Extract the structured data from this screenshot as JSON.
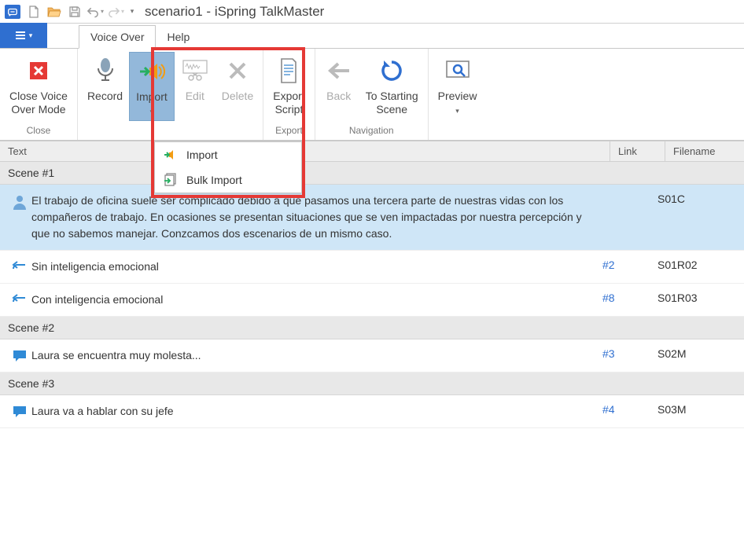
{
  "title": "scenario1 - iSpring TalkMaster",
  "tabs": {
    "voice_over": "Voice Over",
    "help": "Help"
  },
  "ribbon": {
    "close": {
      "close_voice_over": "Close Voice\nOver Mode",
      "group_label": "Close"
    },
    "record": "Record",
    "import": "Import",
    "edit": "Edit",
    "delete": "Delete",
    "export": {
      "export_script": "Export\nScript",
      "group_label": "Export"
    },
    "navigation": {
      "back": "Back",
      "to_starting": "To Starting\nScene",
      "group_label": "Navigation"
    },
    "preview": "Preview"
  },
  "import_menu": {
    "import": "Import",
    "bulk_import": "Bulk Import"
  },
  "grid": {
    "text_header": "Text",
    "link_header": "Link",
    "filename_header": "Filename"
  },
  "scenes": [
    {
      "title": "Scene #1",
      "rows": [
        {
          "type": "person",
          "text": "El trabajo de oficina suele ser complicado debido a qué pasamos una tercera parte de nuestras vidas con los compañeros de trabajo. En ocasiones se presentan situaciones que se ven impactadas por nuestra percepción y que no sabemos manejar. Conzcamos dos escenarios de un mismo caso.",
          "link": "",
          "file": "S01C",
          "selected": true
        },
        {
          "type": "reply",
          "text": "Sin inteligencia emocional",
          "link": "#2",
          "file": "S01R02"
        },
        {
          "type": "reply",
          "text": "Con inteligencia emocional",
          "link": "#8",
          "file": "S01R03"
        }
      ]
    },
    {
      "title": "Scene #2",
      "rows": [
        {
          "type": "message",
          "text": "Laura se encuentra muy molesta...",
          "link": "#3",
          "file": "S02M"
        }
      ]
    },
    {
      "title": "Scene #3",
      "rows": [
        {
          "type": "message",
          "text": "Laura va a hablar con su jefe",
          "link": "#4",
          "file": "S03M"
        }
      ]
    }
  ]
}
